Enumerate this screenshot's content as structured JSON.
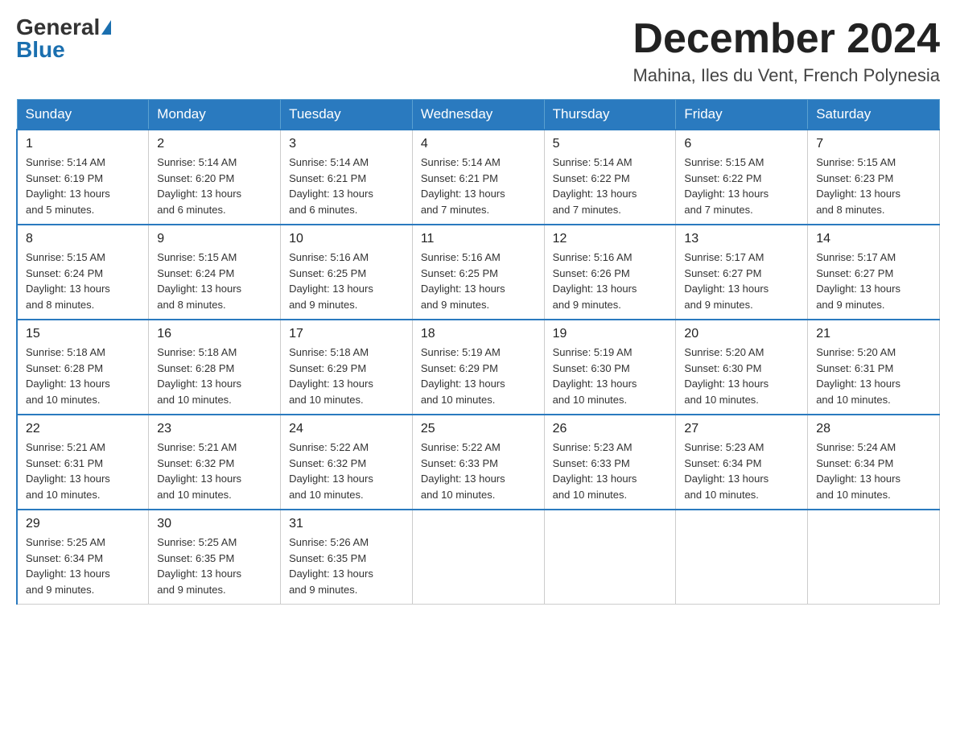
{
  "header": {
    "logo_general": "General",
    "logo_blue": "Blue",
    "month_title": "December 2024",
    "location": "Mahina, Iles du Vent, French Polynesia"
  },
  "weekdays": [
    "Sunday",
    "Monday",
    "Tuesday",
    "Wednesday",
    "Thursday",
    "Friday",
    "Saturday"
  ],
  "weeks": [
    [
      {
        "day": "1",
        "sunrise": "5:14 AM",
        "sunset": "6:19 PM",
        "daylight": "13 hours and 5 minutes."
      },
      {
        "day": "2",
        "sunrise": "5:14 AM",
        "sunset": "6:20 PM",
        "daylight": "13 hours and 6 minutes."
      },
      {
        "day": "3",
        "sunrise": "5:14 AM",
        "sunset": "6:21 PM",
        "daylight": "13 hours and 6 minutes."
      },
      {
        "day": "4",
        "sunrise": "5:14 AM",
        "sunset": "6:21 PM",
        "daylight": "13 hours and 7 minutes."
      },
      {
        "day": "5",
        "sunrise": "5:14 AM",
        "sunset": "6:22 PM",
        "daylight": "13 hours and 7 minutes."
      },
      {
        "day": "6",
        "sunrise": "5:15 AM",
        "sunset": "6:22 PM",
        "daylight": "13 hours and 7 minutes."
      },
      {
        "day": "7",
        "sunrise": "5:15 AM",
        "sunset": "6:23 PM",
        "daylight": "13 hours and 8 minutes."
      }
    ],
    [
      {
        "day": "8",
        "sunrise": "5:15 AM",
        "sunset": "6:24 PM",
        "daylight": "13 hours and 8 minutes."
      },
      {
        "day": "9",
        "sunrise": "5:15 AM",
        "sunset": "6:24 PM",
        "daylight": "13 hours and 8 minutes."
      },
      {
        "day": "10",
        "sunrise": "5:16 AM",
        "sunset": "6:25 PM",
        "daylight": "13 hours and 9 minutes."
      },
      {
        "day": "11",
        "sunrise": "5:16 AM",
        "sunset": "6:25 PM",
        "daylight": "13 hours and 9 minutes."
      },
      {
        "day": "12",
        "sunrise": "5:16 AM",
        "sunset": "6:26 PM",
        "daylight": "13 hours and 9 minutes."
      },
      {
        "day": "13",
        "sunrise": "5:17 AM",
        "sunset": "6:27 PM",
        "daylight": "13 hours and 9 minutes."
      },
      {
        "day": "14",
        "sunrise": "5:17 AM",
        "sunset": "6:27 PM",
        "daylight": "13 hours and 9 minutes."
      }
    ],
    [
      {
        "day": "15",
        "sunrise": "5:18 AM",
        "sunset": "6:28 PM",
        "daylight": "13 hours and 10 minutes."
      },
      {
        "day": "16",
        "sunrise": "5:18 AM",
        "sunset": "6:28 PM",
        "daylight": "13 hours and 10 minutes."
      },
      {
        "day": "17",
        "sunrise": "5:18 AM",
        "sunset": "6:29 PM",
        "daylight": "13 hours and 10 minutes."
      },
      {
        "day": "18",
        "sunrise": "5:19 AM",
        "sunset": "6:29 PM",
        "daylight": "13 hours and 10 minutes."
      },
      {
        "day": "19",
        "sunrise": "5:19 AM",
        "sunset": "6:30 PM",
        "daylight": "13 hours and 10 minutes."
      },
      {
        "day": "20",
        "sunrise": "5:20 AM",
        "sunset": "6:30 PM",
        "daylight": "13 hours and 10 minutes."
      },
      {
        "day": "21",
        "sunrise": "5:20 AM",
        "sunset": "6:31 PM",
        "daylight": "13 hours and 10 minutes."
      }
    ],
    [
      {
        "day": "22",
        "sunrise": "5:21 AM",
        "sunset": "6:31 PM",
        "daylight": "13 hours and 10 minutes."
      },
      {
        "day": "23",
        "sunrise": "5:21 AM",
        "sunset": "6:32 PM",
        "daylight": "13 hours and 10 minutes."
      },
      {
        "day": "24",
        "sunrise": "5:22 AM",
        "sunset": "6:32 PM",
        "daylight": "13 hours and 10 minutes."
      },
      {
        "day": "25",
        "sunrise": "5:22 AM",
        "sunset": "6:33 PM",
        "daylight": "13 hours and 10 minutes."
      },
      {
        "day": "26",
        "sunrise": "5:23 AM",
        "sunset": "6:33 PM",
        "daylight": "13 hours and 10 minutes."
      },
      {
        "day": "27",
        "sunrise": "5:23 AM",
        "sunset": "6:34 PM",
        "daylight": "13 hours and 10 minutes."
      },
      {
        "day": "28",
        "sunrise": "5:24 AM",
        "sunset": "6:34 PM",
        "daylight": "13 hours and 10 minutes."
      }
    ],
    [
      {
        "day": "29",
        "sunrise": "5:25 AM",
        "sunset": "6:34 PM",
        "daylight": "13 hours and 9 minutes."
      },
      {
        "day": "30",
        "sunrise": "5:25 AM",
        "sunset": "6:35 PM",
        "daylight": "13 hours and 9 minutes."
      },
      {
        "day": "31",
        "sunrise": "5:26 AM",
        "sunset": "6:35 PM",
        "daylight": "13 hours and 9 minutes."
      },
      null,
      null,
      null,
      null
    ]
  ],
  "labels": {
    "sunrise_prefix": "Sunrise: ",
    "sunset_prefix": "Sunset: ",
    "daylight_prefix": "Daylight: "
  }
}
